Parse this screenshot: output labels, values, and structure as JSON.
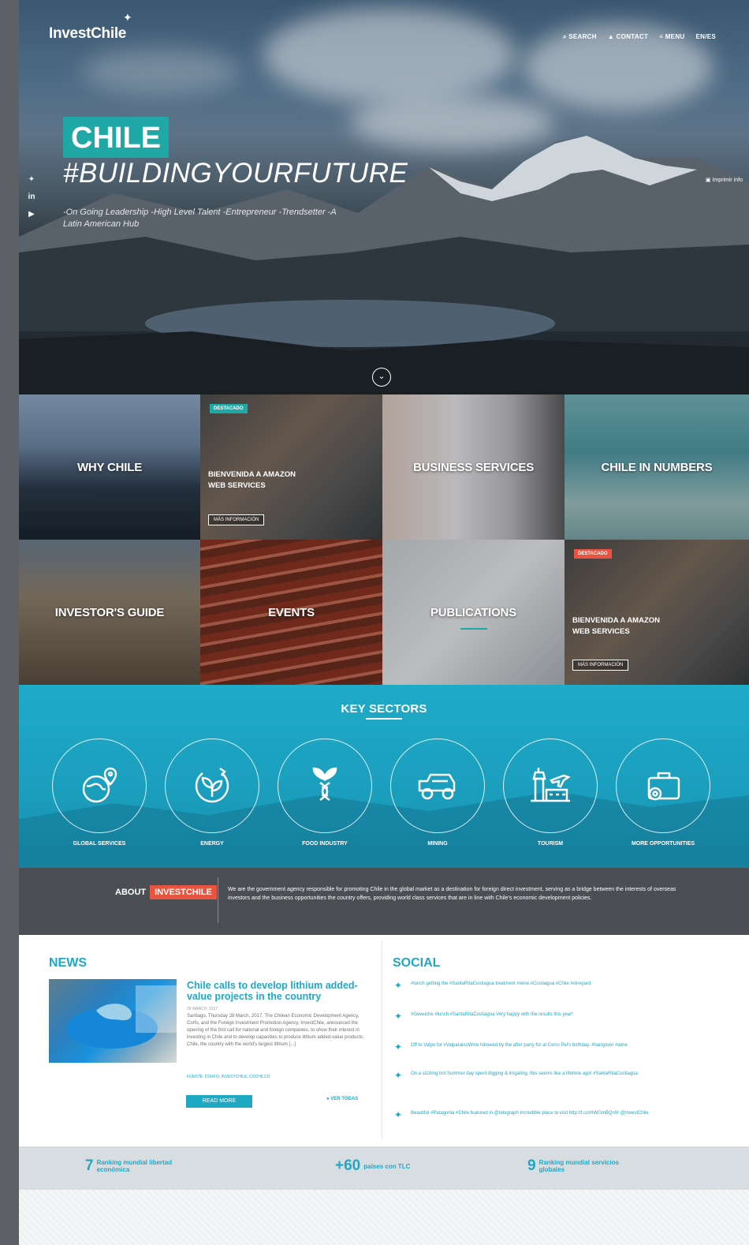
{
  "brand": {
    "logo_text": "InvestChile"
  },
  "topnav": [
    "SEARCH",
    "CONTACT",
    "MENU",
    "EN/ES"
  ],
  "social_side": [
    "twitter",
    "linkedin",
    "youtube"
  ],
  "hero": {
    "badge": "CHILE",
    "hashtag": "#BUILDINGYOURFUTURE",
    "subtitle": "-On Going Leadership -High Level Talent -Entrepreneur -Trendsetter -A Latin American Hub",
    "right_link": "Imprimir info"
  },
  "tiles": [
    {
      "label": "WHY CHILE"
    },
    {
      "badge": "DESTACADO",
      "promo": "BIENVENIDA A AMAZON WEB SERVICES",
      "button": "MÁS INFORMACIÓN"
    },
    {
      "label": "BUSINESS SERVICES"
    },
    {
      "label": "CHILE IN NUMBERS"
    },
    {
      "label": "INVESTOR'S GUIDE"
    },
    {
      "label": "EVENTS"
    },
    {
      "label": "PUBLICATIONS"
    },
    {
      "badge": "DESTACADO",
      "promo": "BIENVENIDA A AMAZON WEB SERVICES",
      "button": "MÁS INFORMACIÓN"
    }
  ],
  "sectors": {
    "title": "KEY SECTORS",
    "items": [
      {
        "label": "GLOBAL SERVICES",
        "icon": "globe-pins-icon"
      },
      {
        "label": "ENERGY",
        "icon": "energy-leaf-icon"
      },
      {
        "label": "FOOD INDUSTRY",
        "icon": "dna-plant-icon"
      },
      {
        "label": "MINING",
        "icon": "mining-truck-icon"
      },
      {
        "label": "TOURISM",
        "icon": "tower-plane-icon"
      },
      {
        "label": "MORE OPPORTUNITIES",
        "icon": "briefcase-icon"
      }
    ]
  },
  "about": {
    "label": "ABOUT",
    "highlight": "INVESTCHILE",
    "text": "We are the government agency responsible for promoting Chile in the global market as a destination for foreign direct investment, serving as a bridge between the interests of overseas investors and the business opportunities the country offers, providing world class services that are in line with Chile's economic development policies."
  },
  "news": {
    "heading": "NEWS",
    "title": "Chile calls to develop lithium added-value projects in the country",
    "date": "28 MARCH, 2017",
    "body": "Santiago, Thursday 28 March, 2017. The Chilean Economic Development Agency, Corfo, and the Foreign Investment Promotion Agency, InvestChile, announced the opening of the first call for national and foreign companies, to show their interest in investing in Chile and to develop capacities to produce lithium added-value products. Chile, the country with the world's largest lithium [...]",
    "source": "FUENTE: CORFO, INVESTCHILE, COCHILCO",
    "read_more": "READ MORE",
    "see_all": "VER TODAS"
  },
  "social": {
    "heading": "SOCIAL",
    "tweets": [
      "#lunch getting the #SantaRitaCostiagua treatment #wine #Costiagua #Chile #vineyard",
      "#Gewuche #lunch #SantaRitaCostiagua Very happy with the results this year!",
      "Off to Valpo for #ValparaisoWine followed by the after party for at Cerro Pel's birthday. #hangover #wine",
      "On a sizzling hot Summer day spent digging & irrigating, this seems like a lifetime ago! #SantaRitaCostiagua",
      "Beautiful #Patagonia #Chile featured in @telegraph Incredible place to visit http://t.co/HWGmBQn0r @InvestChile"
    ]
  },
  "stats": [
    {
      "num": "7",
      "label": "Ranking mundial libertad económica"
    },
    {
      "num": "+60",
      "label": "países con TLC"
    },
    {
      "num": "9",
      "label": "Ranking mundial servicios globales"
    }
  ]
}
